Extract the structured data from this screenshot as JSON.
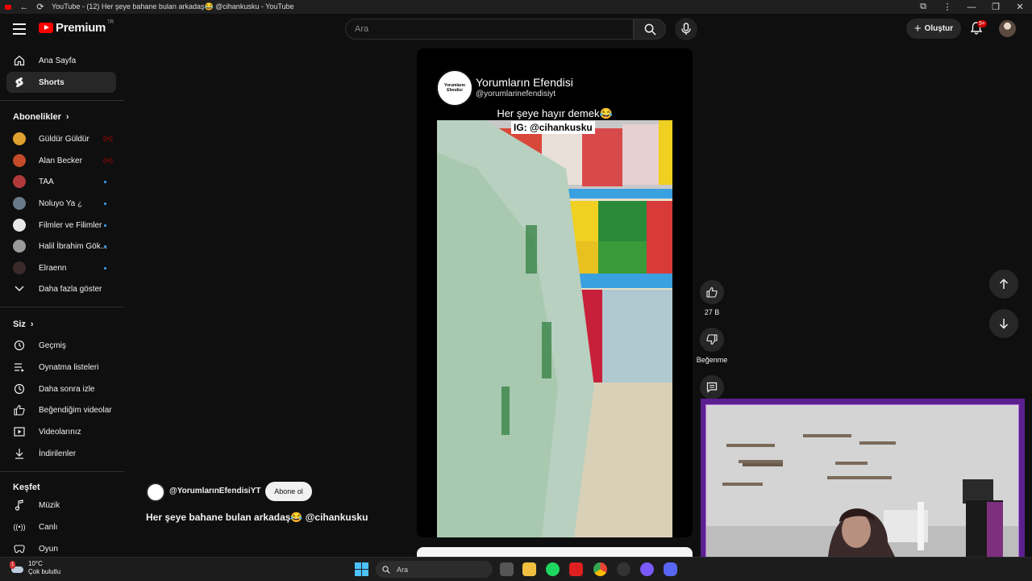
{
  "window": {
    "title": "YouTube - (12) Her şeye bahane bulan arkadaş😂 @cihankusku - YouTube"
  },
  "header": {
    "logo_text": "Premium",
    "logo_badge": "TR",
    "search_placeholder": "Ara",
    "create_label": "Oluştur",
    "notification_count": "9+"
  },
  "sidebar": {
    "main": [
      {
        "label": "Ana Sayfa",
        "icon": "home-icon"
      },
      {
        "label": "Shorts",
        "icon": "shorts-icon",
        "active": true
      }
    ],
    "subscriptions_heading": "Abonelikler",
    "subscriptions": [
      {
        "label": "Güldür Güldür",
        "status": "live",
        "color": "#e0a030"
      },
      {
        "label": "Alan Becker",
        "status": "live",
        "color": "#c44a2a"
      },
      {
        "label": "TAA",
        "status": "new",
        "color": "#b03a3a"
      },
      {
        "label": "Noluyo Ya ¿",
        "status": "new",
        "color": "#6a7a8a"
      },
      {
        "label": "Filmler ve Filimler",
        "status": "new",
        "color": "#e8e8e8"
      },
      {
        "label": "Halil İbrahim Gök...",
        "status": "new",
        "color": "#9a9a9a"
      },
      {
        "label": "Elraenn",
        "status": "new",
        "color": "#3a2a2a"
      }
    ],
    "show_more_label": "Daha fazla göster",
    "you_heading": "Siz",
    "you_items": [
      {
        "label": "Geçmiş",
        "icon": "history-icon"
      },
      {
        "label": "Oynatma listeleri",
        "icon": "playlists-icon"
      },
      {
        "label": "Daha sonra izle",
        "icon": "watch-later-icon"
      },
      {
        "label": "Beğendiğim videolar",
        "icon": "liked-videos-icon"
      },
      {
        "label": "Videolarınız",
        "icon": "your-videos-icon"
      },
      {
        "label": "İndirilenler",
        "icon": "downloads-icon"
      }
    ],
    "explore_heading": "Keşfet",
    "explore_items": [
      {
        "label": "Müzik",
        "icon": "music-icon"
      },
      {
        "label": "Canlı",
        "icon": "live-icon"
      },
      {
        "label": "Oyun",
        "icon": "gaming-icon"
      }
    ]
  },
  "short": {
    "overlay_channel_logo": "Yorumların Efendisi",
    "overlay_channel_name": "Yorumların Efendisi",
    "overlay_channel_handle": "@yorumlarinefendisiyt",
    "overlay_caption": "Her şeye hayır demek😂",
    "overlay_ig": "IG: @cihankusku",
    "channel_handle": "@YorumlarınEfendisiYT",
    "subscribe_label": "Abone ol",
    "title": "Her şeye bahane bulan arkadaş😂 @cihankusku",
    "like_count": "27 B",
    "dislike_label": "Beğenme"
  },
  "taskbar": {
    "temperature": "10°C",
    "weather_desc": "Çok bulutlu",
    "weather_badge": "1",
    "search_placeholder": "Ara"
  }
}
